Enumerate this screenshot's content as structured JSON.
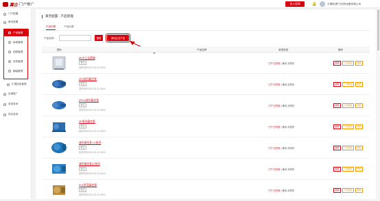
{
  "header": {
    "logo_main": "翼企",
    "logo_sub": "门户推广",
    "cta_label": "进入官网",
    "company": "万德斯(厦门)机电设备有限公司"
  },
  "sidebar": {
    "items": [
      {
        "label": "门户配置",
        "icon": "portal-icon"
      },
      {
        "label": "黄页配置",
        "icon": "yellowpage-icon"
      }
    ],
    "subitems": [
      {
        "label": "产品管理",
        "icon": "product-icon",
        "active": true
      },
      {
        "label": "新闻管理",
        "icon": "news-icon",
        "active": false
      },
      {
        "label": "视频管理",
        "icon": "video-icon",
        "active": false
      },
      {
        "label": "资质管理",
        "icon": "cert-icon",
        "active": false
      },
      {
        "label": "横幅管理",
        "icon": "banner-icon",
        "active": false
      }
    ],
    "extra": [
      {
        "label": "扩展信息管理",
        "icon": "extend-icon"
      },
      {
        "label": "百度推广",
        "icon": "baidu-icon"
      },
      {
        "label": "收录查询",
        "icon": "index-icon"
      },
      {
        "label": "排名查询",
        "icon": "rank-icon"
      }
    ]
  },
  "main": {
    "breadcrumb": "黄页配置 - 产品管理",
    "tabs": [
      {
        "label": "产品列表",
        "active": true
      },
      {
        "label": "产品分类",
        "active": false
      }
    ],
    "search_label": "产品名称：",
    "search_placeholder": "",
    "search_button": "搜索",
    "add_button": "添加企业产品",
    "columns": [
      "图片",
      "产品名称",
      "收录状态",
      "操作"
    ],
    "rows": [
      {
        "name": "MVR工业蒸馏",
        "tag": "默认",
        "time": "发布时间:2023-03-23 08:53",
        "status_red": "门户:已同步",
        "status_gray": "| 黄页:未同步"
      },
      {
        "name": "ZP2系列真空泵",
        "tag": "默认",
        "time": "发布时间:2023-03-23 08:53",
        "status_red": "门户:已同步",
        "status_gray": "| 黄页:未同步"
      },
      {
        "name": "ZP2.5系列真空泵",
        "tag": "默认",
        "time": "发布时间:2023-03-23 08:53",
        "status_red": "门户:已同步",
        "status_gray": "| 黄页:未同步"
      },
      {
        "name": "ZP系列真空泵",
        "tag": "默认",
        "time": "发布时间:2023-03-23 08:53",
        "status_red": "门户:已同步",
        "status_gray": "| 黄页:未同步"
      },
      {
        "name": "液环真空泵 LX系列",
        "tag": "默认",
        "time": "发布时间:2023-03-23 08:53",
        "status_red": "门户:已同步",
        "status_gray": "| 黄页:未同步"
      },
      {
        "name": "液环真空泵ZJ系列",
        "tag": "默认",
        "time": "发布时间:2023-03-23 08:53",
        "status_red": "门户:已同步",
        "status_gray": "| 黄页:未同步"
      },
      {
        "name": "PLK罗茨真空泵",
        "tag": "默认",
        "time": "发布时间:2023-03-23 08:53",
        "status_red": "门户:已同步",
        "status_gray": "| 黄页:未同步"
      }
    ],
    "ops": [
      "编辑",
      "下线排名",
      "删除"
    ]
  },
  "colors": {
    "accent": "#d9000d",
    "warn": "#f39800"
  }
}
